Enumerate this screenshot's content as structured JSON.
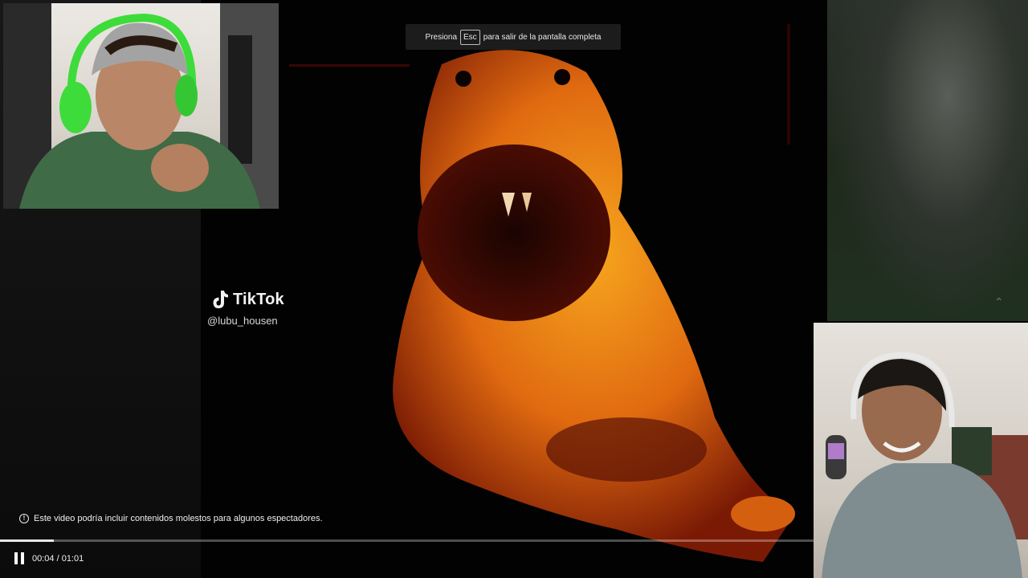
{
  "fullscreen_toast": {
    "prefix": "Presiona",
    "key": "Esc",
    "suffix": "para salir de la pantalla completa"
  },
  "watermark": {
    "brand": "TikTok",
    "handle": "@lubu_housen"
  },
  "warning": {
    "icon": "info-icon",
    "text": "Este video podría incluir contenidos molestos para algunos espectadores."
  },
  "player": {
    "time": "00:04 / 01:01",
    "progress_fraction": 0.066,
    "state": "playing"
  },
  "colors": {
    "creature": "#f08a16",
    "background": "#020202",
    "headset": "#3ddc3b"
  }
}
